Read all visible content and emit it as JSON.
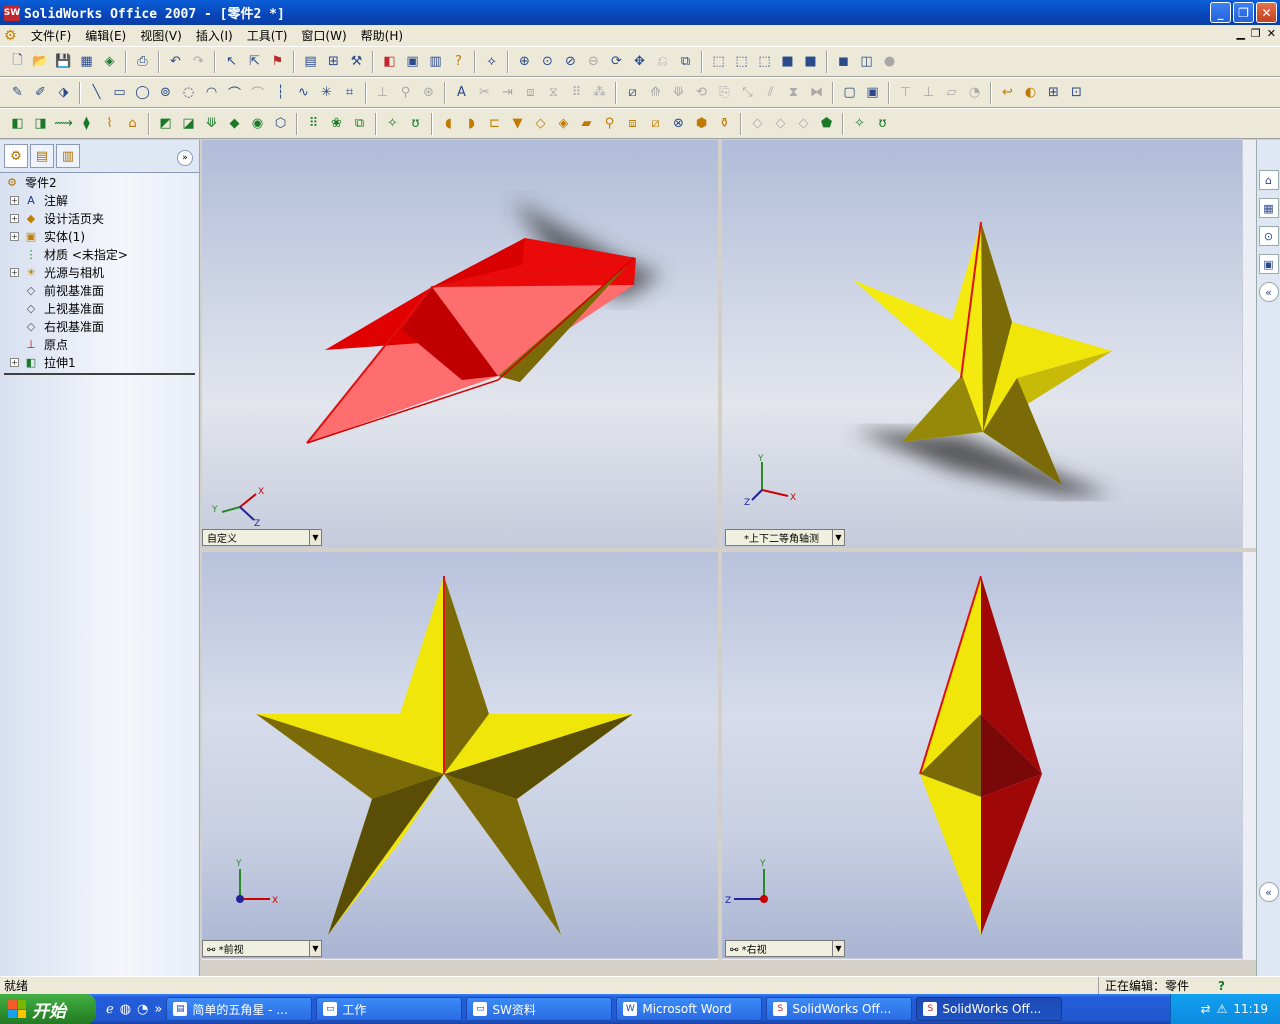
{
  "titlebar": {
    "title": "SolidWorks Office 2007 - [零件2 *]",
    "app_icon": "SW"
  },
  "menu": [
    "文件(F)",
    "编辑(E)",
    "视图(V)",
    "插入(I)",
    "工具(T)",
    "窗口(W)",
    "帮助(H)"
  ],
  "feature_tree": {
    "root": "零件2",
    "items": [
      {
        "label": "注解",
        "expand": true,
        "icon": "annotation-icon"
      },
      {
        "label": "设计活页夹",
        "expand": true,
        "icon": "binder-icon"
      },
      {
        "label": "实体(1)",
        "expand": true,
        "icon": "solid-body-icon"
      },
      {
        "label": "材质 <未指定>",
        "expand": false,
        "icon": "material-icon"
      },
      {
        "label": "光源与相机",
        "expand": true,
        "icon": "lights-cameras-icon"
      },
      {
        "label": "前视基准面",
        "expand": false,
        "icon": "plane-icon"
      },
      {
        "label": "上视基准面",
        "expand": false,
        "icon": "plane-icon"
      },
      {
        "label": "右视基准面",
        "expand": false,
        "icon": "plane-icon"
      },
      {
        "label": "原点",
        "expand": false,
        "icon": "origin-icon"
      },
      {
        "label": "拉伸1",
        "expand": true,
        "icon": "extrude-icon"
      }
    ]
  },
  "viewports": {
    "top_left": {
      "label": "自定义"
    },
    "top_right": {
      "label": "*上下二等角轴测"
    },
    "bottom_left": {
      "label": "*前视"
    },
    "bottom_right": {
      "label": "*右视"
    }
  },
  "triad": {
    "x": "X",
    "y": "Y",
    "z": "Z"
  },
  "status": {
    "left": "就绪",
    "right": "正在编辑：零件",
    "help": "?"
  },
  "taskbar": {
    "start": "开始",
    "buttons": [
      "简单的五角星 - ...",
      "工作",
      "SW资料",
      "Microsoft Word",
      "SolidWorks Off...",
      "SolidWorks Off..."
    ],
    "clock": "11:19"
  },
  "colors": {
    "star_yellow": "#f0e60a",
    "star_dark": "#7a6a08",
    "star_red": "#e01010",
    "star_pink": "#ff7070"
  }
}
